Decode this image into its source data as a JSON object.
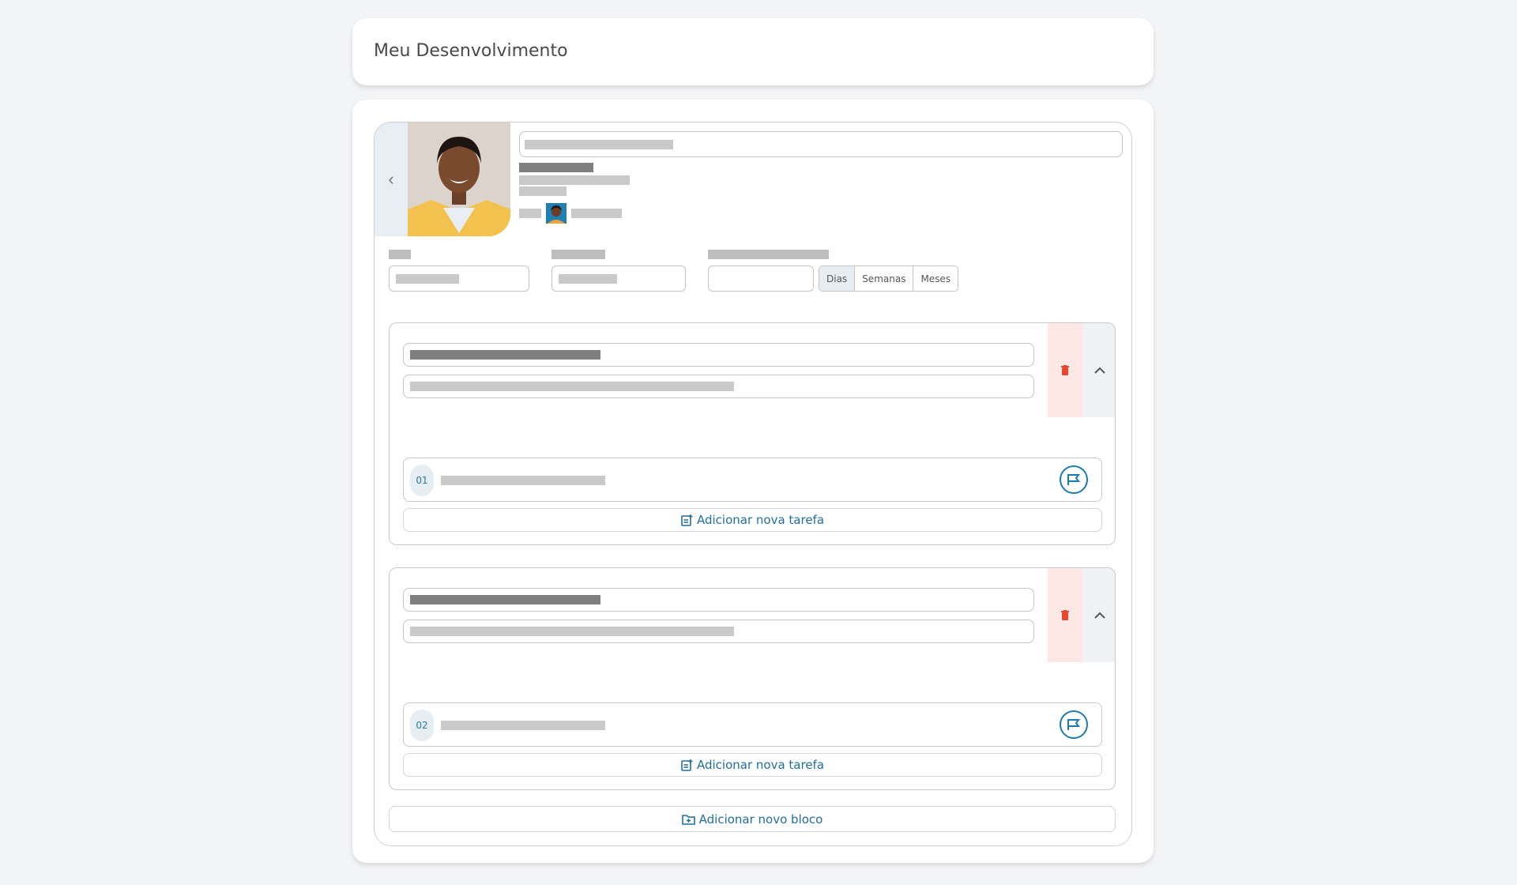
{
  "page": {
    "title": "Meu Desenvolvimento"
  },
  "period_units": {
    "options": [
      "Dias",
      "Semanas",
      "Meses"
    ],
    "selected": "Dias"
  },
  "blocks": [
    {
      "task_number": "01",
      "add_task_label": "Adicionar nova tarefa"
    },
    {
      "task_number": "02",
      "add_task_label": "Adicionar nova tarefa"
    }
  ],
  "add_block_label": "Adicionar novo bloco",
  "colors": {
    "accent": "#1b7bb0",
    "danger": "#e8472f",
    "danger_bg": "#fde8e6"
  },
  "icons": {
    "back": "chevron-left-icon",
    "delete": "trash-icon",
    "collapse": "chevron-up-icon",
    "flag": "flag-icon",
    "add_task": "add-note-icon",
    "add_block": "add-folder-icon"
  }
}
